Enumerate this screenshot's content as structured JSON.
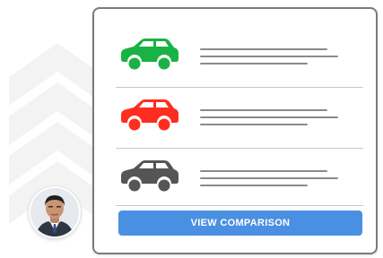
{
  "comparison_card": {
    "items": [
      {
        "icon": "car-icon",
        "color": "#1ab244"
      },
      {
        "icon": "car-icon",
        "color": "#ff2d20"
      },
      {
        "icon": "car-icon",
        "color": "#555555"
      }
    ],
    "cta_label": "VIEW COMPARISON",
    "cta_color": "#4a90e2"
  },
  "avatar": {
    "icon": "person-avatar"
  }
}
